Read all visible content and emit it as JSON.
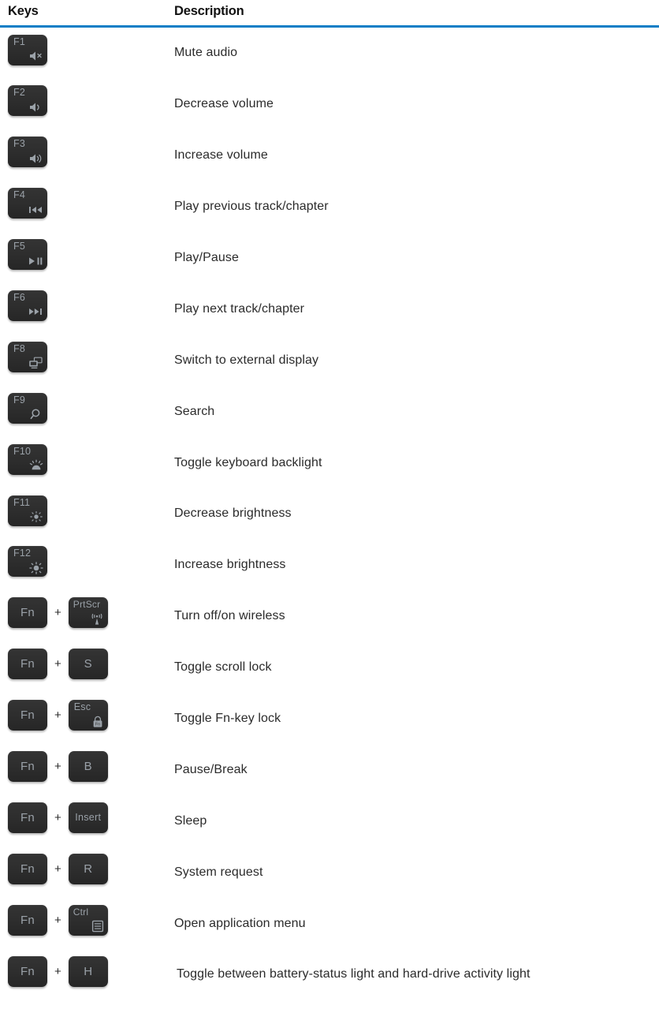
{
  "table": {
    "headers": {
      "keys": "Keys",
      "description": "Description"
    },
    "accent_color": "#0c7ec6",
    "keycap_color": "#2e2e2e",
    "keycap_text_color": "#9aa1a8",
    "rows": [
      {
        "keys": [
          {
            "label": "F1",
            "icon": "speaker-mute-icon"
          }
        ],
        "description": "Mute audio"
      },
      {
        "keys": [
          {
            "label": "F2",
            "icon": "speaker-low-icon"
          }
        ],
        "description": "Decrease volume"
      },
      {
        "keys": [
          {
            "label": "F3",
            "icon": "speaker-high-icon"
          }
        ],
        "description": "Increase volume"
      },
      {
        "keys": [
          {
            "label": "F4",
            "icon": "previous-track-icon"
          }
        ],
        "description": "Play previous track/chapter"
      },
      {
        "keys": [
          {
            "label": "F5",
            "icon": "play-pause-icon"
          }
        ],
        "description": "Play/Pause"
      },
      {
        "keys": [
          {
            "label": "F6",
            "icon": "next-track-icon"
          }
        ],
        "description": "Play next track/chapter"
      },
      {
        "keys": [
          {
            "label": "F8",
            "icon": "external-display-icon"
          }
        ],
        "description": "Switch to external display"
      },
      {
        "keys": [
          {
            "label": "F9",
            "icon": "search-icon"
          }
        ],
        "description": "Search"
      },
      {
        "keys": [
          {
            "label": "F10",
            "icon": "keyboard-backlight-icon"
          }
        ],
        "description": "Toggle keyboard backlight"
      },
      {
        "keys": [
          {
            "label": "F11",
            "icon": "brightness-low-icon"
          }
        ],
        "description": "Decrease brightness"
      },
      {
        "keys": [
          {
            "label": "F12",
            "icon": "brightness-high-icon"
          }
        ],
        "description": "Increase brightness"
      },
      {
        "keys": [
          {
            "label": "Fn",
            "icon": null,
            "centered": true
          },
          {
            "separator": "+"
          },
          {
            "label": "PrtScr",
            "icon": "wireless-tower-icon"
          }
        ],
        "description": "Turn off/on wireless"
      },
      {
        "keys": [
          {
            "label": "Fn",
            "icon": null,
            "centered": true
          },
          {
            "separator": "+"
          },
          {
            "label": "S",
            "icon": null,
            "centered": true
          }
        ],
        "description": "Toggle scroll lock"
      },
      {
        "keys": [
          {
            "label": "Fn",
            "icon": null,
            "centered": true
          },
          {
            "separator": "+"
          },
          {
            "label": "Esc",
            "icon": "fn-lock-icon"
          }
        ],
        "description": "Toggle Fn-key lock"
      },
      {
        "keys": [
          {
            "label": "Fn",
            "icon": null,
            "centered": true
          },
          {
            "separator": "+"
          },
          {
            "label": "B",
            "icon": null,
            "centered": true
          }
        ],
        "description": "Pause/Break"
      },
      {
        "keys": [
          {
            "label": "Fn",
            "icon": null,
            "centered": true
          },
          {
            "separator": "+"
          },
          {
            "label": "Insert",
            "icon": null,
            "centered": true,
            "small": true
          }
        ],
        "description": "Sleep"
      },
      {
        "keys": [
          {
            "label": "Fn",
            "icon": null,
            "centered": true
          },
          {
            "separator": "+"
          },
          {
            "label": "R",
            "icon": null,
            "centered": true
          }
        ],
        "description": "System request"
      },
      {
        "keys": [
          {
            "label": "Fn",
            "icon": null,
            "centered": true
          },
          {
            "separator": "+"
          },
          {
            "label": "Ctrl",
            "icon": "application-menu-icon"
          }
        ],
        "description": "Open application menu"
      },
      {
        "keys": [
          {
            "label": "Fn",
            "icon": null,
            "centered": true
          },
          {
            "separator": "+"
          },
          {
            "label": "H",
            "icon": null,
            "centered": true
          }
        ],
        "description": "Toggle between battery-status light and hard-drive activity light",
        "indented": true
      }
    ]
  }
}
